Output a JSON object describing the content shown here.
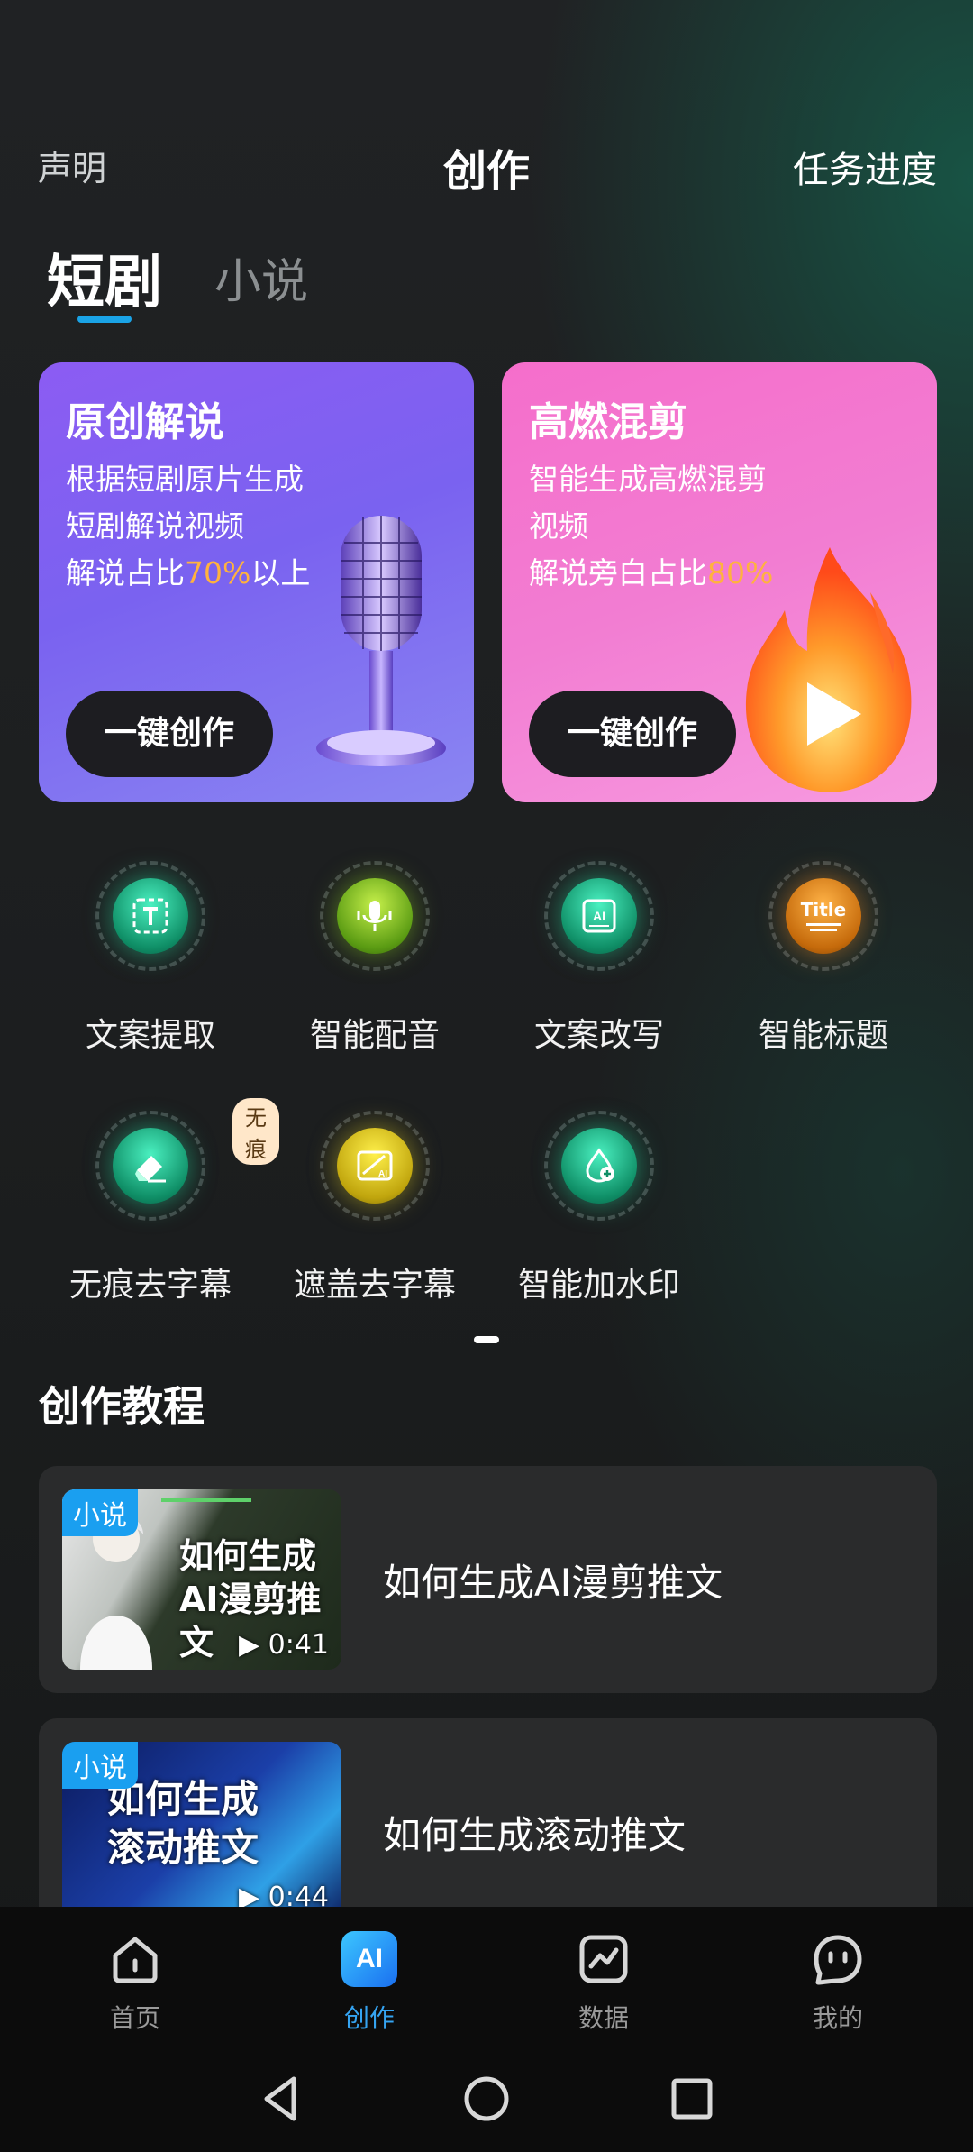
{
  "header": {
    "left": "声明",
    "title": "创作",
    "right": "任务进度"
  },
  "tabs": [
    {
      "label": "短剧",
      "active": true
    },
    {
      "label": "小说",
      "active": false
    }
  ],
  "cards": [
    {
      "title": "原创解说",
      "line1": "根据短剧原片生成",
      "line2": "短剧解说视频",
      "line3_prefix": "解说占比",
      "line3_highlight": "70%",
      "line3_suffix": "以上",
      "button": "一键创作",
      "illustration": "microphone",
      "highlight_color": "#ffb23e"
    },
    {
      "title": "高燃混剪",
      "line1": "智能生成高燃混剪",
      "line2": "视频",
      "line3_prefix": "解说旁白占比",
      "line3_highlight": "80%",
      "line3_suffix": "",
      "button": "一键创作",
      "illustration": "fire-play"
    }
  ],
  "tools": [
    {
      "label": "文案提取",
      "icon": "text-extract-icon"
    },
    {
      "label": "智能配音",
      "icon": "voice-dub-icon"
    },
    {
      "label": "文案改写",
      "icon": "ai-rewrite-icon"
    },
    {
      "label": "智能标题",
      "icon": "title-icon",
      "icon_text": "Title"
    },
    {
      "label": "无痕去字幕",
      "icon": "eraser-icon",
      "badge": "无痕"
    },
    {
      "label": "遮盖去字幕",
      "icon": "cover-subtitle-icon"
    },
    {
      "label": "智能加水印",
      "icon": "watermark-icon"
    }
  ],
  "tutorials": {
    "title": "创作教程",
    "items": [
      {
        "tag": "小说",
        "thumb_line1": "如何生成",
        "thumb_line2": "AI漫剪推文",
        "duration": "▶ 0:41",
        "title": "如何生成AI漫剪推文"
      },
      {
        "tag": "小说",
        "thumb_line1": "如何生成",
        "thumb_line2": "滚动推文",
        "duration": "▶ 0:44",
        "title": "如何生成滚动推文"
      }
    ]
  },
  "nav": [
    {
      "label": "首页",
      "icon": "home-icon",
      "active": false
    },
    {
      "label": "创作",
      "icon": "ai-icon",
      "icon_text": "AI",
      "active": true
    },
    {
      "label": "数据",
      "icon": "chart-icon",
      "active": false
    },
    {
      "label": "我的",
      "icon": "profile-icon",
      "active": false
    }
  ],
  "colors": {
    "accent": "#1aa3e6",
    "nav_active": "#35a4f2",
    "card_purple": "#8c5cf3",
    "card_pink": "#f56ecb"
  }
}
